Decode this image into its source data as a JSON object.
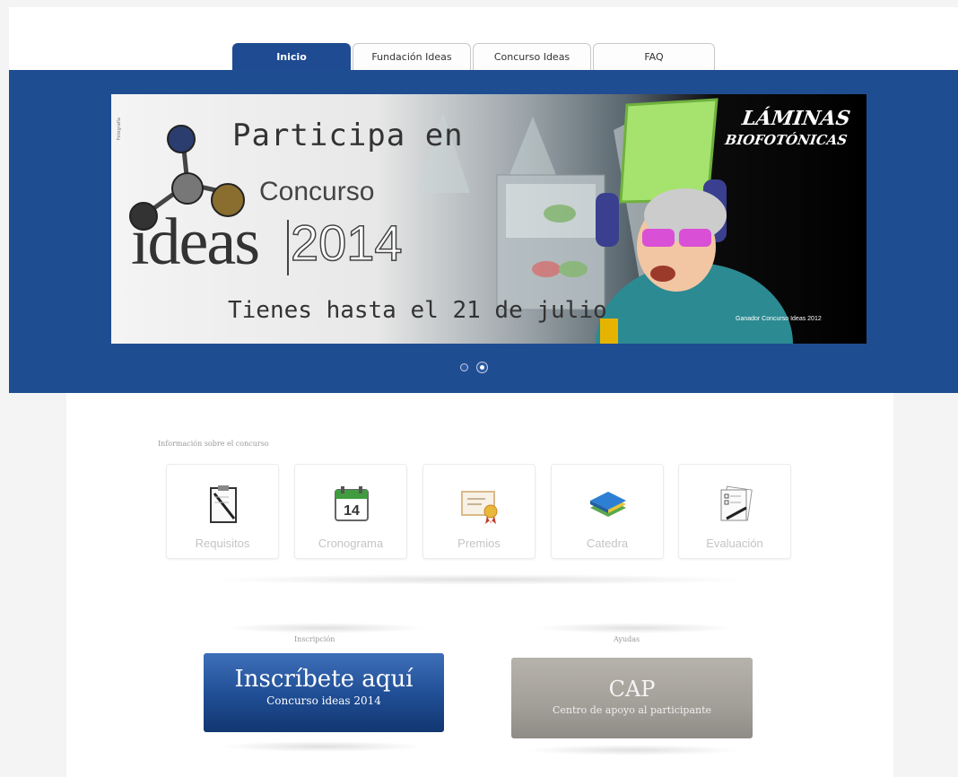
{
  "nav": {
    "tabs": [
      {
        "label": "Inicio",
        "active": true
      },
      {
        "label": "Fundación Ideas",
        "active": false
      },
      {
        "label": "Concurso Ideas",
        "active": false
      },
      {
        "label": "FAQ",
        "active": false
      }
    ]
  },
  "banner": {
    "line1": "Participa en",
    "line2": "Concurso",
    "brand": "ideas",
    "year": "2014",
    "deadline": "Tienes hasta el 21 de julio",
    "product_title": "LÁMINAS",
    "product_subtitle": "BIOFOTÓNICAS",
    "caption": "Ganador Concurso Ideas 2012",
    "slides_total": 2,
    "slide_active": 2
  },
  "info": {
    "section_label": "Información sobre el concurso",
    "cards": [
      {
        "label": "Requisitos",
        "icon": "clipboard-icon"
      },
      {
        "label": "Cronograma",
        "icon": "calendar-icon"
      },
      {
        "label": "Premios",
        "icon": "certificate-icon"
      },
      {
        "label": "Catedra",
        "icon": "books-icon"
      },
      {
        "label": "Evaluación",
        "icon": "documents-pen-icon"
      }
    ],
    "calendar_day": "14"
  },
  "inscripcion": {
    "section_label": "Inscripción",
    "title": "Inscríbete aquí",
    "subtitle": "Concurso ideas 2014"
  },
  "ayudas": {
    "section_label": "Ayudas",
    "title": "CAP",
    "subtitle": "Centro de apoyo al participante"
  },
  "colors": {
    "brand_blue": "#1f4d92",
    "cta_gray": "#a29f98"
  }
}
